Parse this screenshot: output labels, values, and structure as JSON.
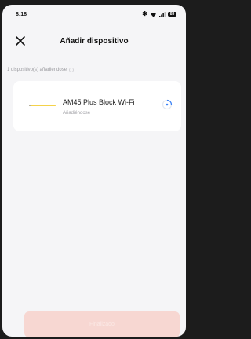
{
  "status_bar": {
    "time": "8:18",
    "battery_label": "83"
  },
  "header": {
    "title": "Añadir dispositivo"
  },
  "progress": {
    "count_text": "1 dispositivo(s) añadiéndose"
  },
  "device": {
    "name": "AM45 Plus Block Wi-Fi",
    "status": "Añadiéndose"
  },
  "footer": {
    "button_label": "Finalizado"
  },
  "colors": {
    "screen_background": "#f5f5f7",
    "card_background": "#ffffff",
    "accent_blue": "#3b82f6",
    "device_yellow": "#f1c40f",
    "button_disabled": "#f7d7d2"
  }
}
